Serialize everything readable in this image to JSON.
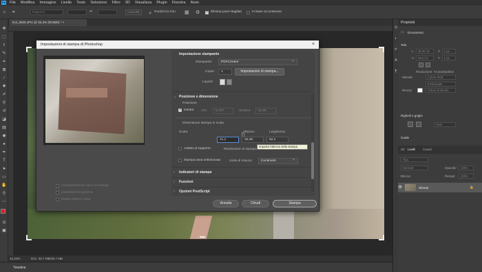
{
  "app": {
    "logo": "Ps"
  },
  "menu": [
    "File",
    "Modifica",
    "Immagine",
    "Livello",
    "Testo",
    "Selezione",
    "Filtro",
    "3D",
    "Visualizza",
    "Plugin",
    "Finestra",
    "Aiuto"
  ],
  "options": {
    "proportion": "Rapporto",
    "clear": "Cancella",
    "straighten": "Raddrizza foto",
    "delete_cropped": "Elimina pixel ritagliati",
    "content_aware": "In base al contenuto"
  },
  "document": {
    "tab_title": "DJI_0628.JPG @ 33,3% (RGB/8) *",
    "tab_close": "×",
    "zoom": "33,33%",
    "doc_info": "Doc: 25,7 MB/25,7 MB"
  },
  "timeline": {
    "label": "Timeline"
  },
  "dialog": {
    "title": "Impostazioni di stampa di Photoshop",
    "close": "×",
    "printer_section": "Impostazione stampante",
    "printer_label": "Stampante:",
    "printer_value": "PDFCreator",
    "copies_label": "Copie:",
    "copies_value": "1",
    "print_settings_button": "Impostazioni di stampa...",
    "layout_label": "Layout:",
    "position_section": "Posizione e dimensione",
    "position_label": "Posizione",
    "center_label": "Centro",
    "center_checked": true,
    "top_label": "Alto:",
    "top_value": "6,707",
    "left_label": "Sinistra:",
    "left_value": "11,68",
    "scaled_label": "Dimensione stampa in scala",
    "scale_label": "Scala:",
    "height_label": "Altezza:",
    "width_label": "Larghezza:",
    "scale_value": "41,1",
    "height_value": "34,36",
    "width_value": "62,1",
    "tooltip": "Imposta l'altezza della stampa",
    "fit_media": "Adatta al supporto",
    "resolution_label": "Risoluzione di stampa:",
    "print_selected": "Stampa area selezionata",
    "units_label": "Unità di misura:",
    "units_value": "Centimetri",
    "print_marks": "Indicatori di stampa",
    "functions": "Funzioni",
    "postscript": "Opzioni PostScript",
    "match_colors": "Corrispondenza colori di stampa",
    "gamut_warning": "Avvertimento gamma",
    "show_paper_white": "Mostra bianco carta",
    "buttons": {
      "cancel": "Annulla",
      "done": "Chiudi",
      "print": "Stampa"
    }
  },
  "panel": {
    "properties_tab": "Proprietà",
    "document_label": "Documento",
    "canvas_label": "Tela",
    "w_label": "L",
    "w_value": "35,25 cm",
    "h_label": "A",
    "h_value": "26,5 cm",
    "x_label": "X",
    "x_value": "0 px",
    "y_label": "Y",
    "y_value": "0 px",
    "resolution": "Risoluzione: 72 pixel/pollice",
    "mode_label": "Metodo",
    "mode_value": "Colore RGB",
    "bits_value": "8 bit/canale",
    "fill_label": "Riempi",
    "fill_value": "Colore di sfondo",
    "rulers_label": "Righelli e griglie",
    "rulers_unit": "Pixel",
    "guides_label": "Guide",
    "tabs": [
      "3D",
      "Livelli",
      "Canali"
    ],
    "search": "Tipo",
    "blend": "Normale",
    "opacity_label": "Opacità:",
    "opacity_value": "100%",
    "lock_label": "Blocca:",
    "fill2_label": "Riempi:",
    "fill2_value": "100%",
    "layer_name": "Sfondo",
    "lock_icon": "🔒"
  },
  "colors": {
    "fg": "#d71f26",
    "bg": "#ffffff",
    "accent": "#31a8ff"
  }
}
